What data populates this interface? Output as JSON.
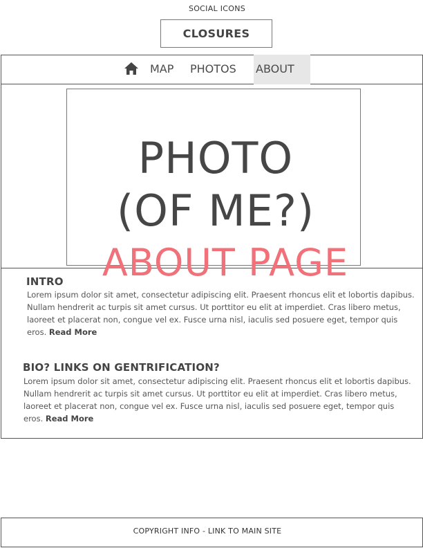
{
  "header": {
    "social_label": "SOCIAL ICONS",
    "logo_label": "CLOSURES"
  },
  "nav": {
    "home_icon": "home-icon",
    "items": [
      {
        "label": "MAP",
        "active": false
      },
      {
        "label": "PHOTOS",
        "active": false
      },
      {
        "label": "ABOUT",
        "active": true
      }
    ]
  },
  "hero": {
    "photo_line1": "PHOTO",
    "photo_line2": "(OF ME?)"
  },
  "overlay": {
    "title": "ABOUT PAGE",
    "color": "#f07179"
  },
  "sections": [
    {
      "heading": "INTRO",
      "body": "Lorem ipsum dolor sit amet, consectetur adipiscing elit. Praesent rhoncus elit et lobortis dapibus. Nullam hendrerit ac turpis sit amet cursus. Ut porttitor eu elit at imperdiet. Cras libero metus, laoreet et placerat non, congue vel ex. Fusce urna nisl, iaculis sed posuere eget, tempor quis eros.",
      "link": "Read More"
    },
    {
      "heading": "BIO? LINKS ON GENTRIFICATION?",
      "body": "Lorem ipsum dolor sit amet, consectetur adipiscing elit. Praesent rhoncus elit et lobortis dapibus. Nullam hendrerit ac turpis sit amet cursus. Ut porttitor eu elit at imperdiet. Cras libero metus, laoreet et placerat non, congue vel ex. Fusce urna nisl, iaculis sed posuere eget, tempor quis eros.",
      "link": "Read More"
    }
  ],
  "footer": {
    "text": "COPYRIGHT INFO - LINK TO MAIN SITE"
  }
}
